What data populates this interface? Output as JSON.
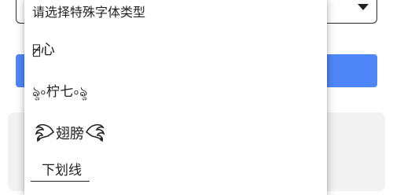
{
  "dropdown": {
    "header_label": "请选择特殊字体类型",
    "options": [
      {
        "label": "带̷̴̷心"
      },
      {
        "label": "ৡ৹柠七৹ৡ"
      },
      {
        "label": "翅膀"
      },
      {
        "label": "下划线"
      }
    ]
  },
  "colors": {
    "primary_button": "#4f86f7",
    "panel_background": "#f2f2f2"
  },
  "icons": {
    "select_arrow": "triangle-down-icon",
    "wing_left": "left-wing-icon",
    "wing_right": "right-wing-icon"
  }
}
